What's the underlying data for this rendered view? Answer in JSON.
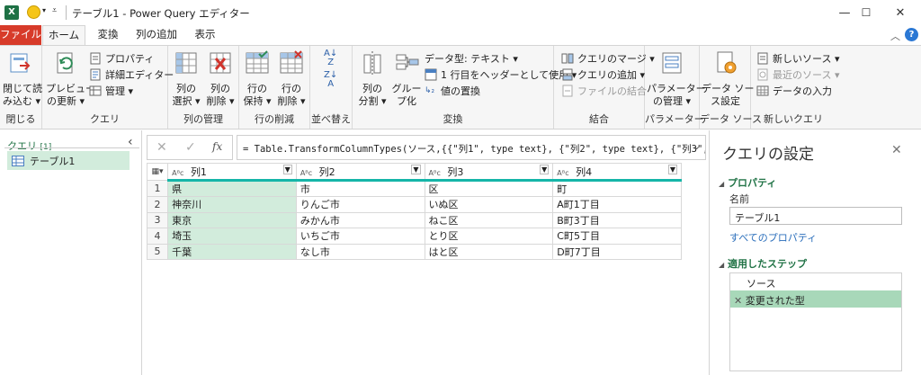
{
  "window": {
    "title": "テーブル1 - Power Query エディター",
    "min": "—",
    "max": "☐",
    "close": "✕"
  },
  "tabs": [
    "ファイル",
    "ホーム",
    "変換",
    "列の追加",
    "表示"
  ],
  "ribbon": {
    "close_group": {
      "btn": [
        "閉じて読",
        "み込む ▾"
      ],
      "label": "閉じる"
    },
    "query_group": {
      "preview": [
        "プレビュー",
        "の更新 ▾"
      ],
      "properties": "プロパティ",
      "advanced": "詳細エディター",
      "manage": "管理 ▾",
      "label": "クエリ"
    },
    "columns_group": {
      "choose": [
        "列の",
        "選択 ▾"
      ],
      "remove": [
        "列の",
        "削除 ▾"
      ],
      "label": "列の管理"
    },
    "rows_group": {
      "keep": [
        "行の",
        "保持 ▾"
      ],
      "remove": [
        "行の",
        "削除 ▾"
      ],
      "label": "行の削減"
    },
    "sort_group": {
      "label": "並べ替え"
    },
    "transform_group": {
      "split": [
        "列の",
        "分割 ▾"
      ],
      "group": [
        "グルー",
        "プ化"
      ],
      "datatype": "データ型: テキスト ▾",
      "header": "1 行目をヘッダーとして使用 ▾",
      "replace": "値の置換",
      "label": "変換"
    },
    "combine_group": {
      "merge": "クエリのマージ ▾",
      "append": "クエリの追加 ▾",
      "files": "ファイルの結合",
      "label": "結合"
    },
    "params_group": {
      "btn": [
        "パラメーター",
        "の管理 ▾"
      ],
      "label": "パラメーター"
    },
    "datasource_group": {
      "btn": [
        "データ ソー",
        "ス設定"
      ],
      "label": "データ ソース"
    },
    "newquery_group": {
      "new": "新しいソース ▾",
      "recent": "最近のソース ▾",
      "enter": "データの入力",
      "label": "新しいクエリ"
    }
  },
  "left": {
    "header": "クエリ",
    "count": "[1]",
    "item": "テーブル1"
  },
  "formula": "= Table.TransformColumnTypes(ソース,{{\"列1\", type text}, {\"列2\", type text}, {\"列3\",",
  "grid": {
    "type_label": "Aᴮᴄ",
    "columns": [
      "列1",
      "列2",
      "列3",
      "列4"
    ],
    "rows": [
      [
        "1",
        "県",
        "市",
        "区",
        "町"
      ],
      [
        "2",
        "神奈川",
        "りんご市",
        "いぬ区",
        "A町1丁目"
      ],
      [
        "3",
        "東京",
        "みかん市",
        "ねこ区",
        "B町3丁目"
      ],
      [
        "4",
        "埼玉",
        "いちご市",
        "とり区",
        "C町5丁目"
      ],
      [
        "5",
        "千葉",
        "なし市",
        "はと区",
        "D町7丁目"
      ]
    ]
  },
  "settings": {
    "title": "クエリの設定",
    "properties_header": "プロパティ",
    "name_label": "名前",
    "name_value": "テーブル1",
    "all_props": "すべてのプロパティ",
    "steps_header": "適用したステップ",
    "steps": [
      "ソース",
      "変更された型"
    ]
  },
  "colors": {
    "accent": "#217346",
    "file_tab": "#d73b2a",
    "selected": "#d2ecdc",
    "type_bar": "#15b5a8"
  }
}
